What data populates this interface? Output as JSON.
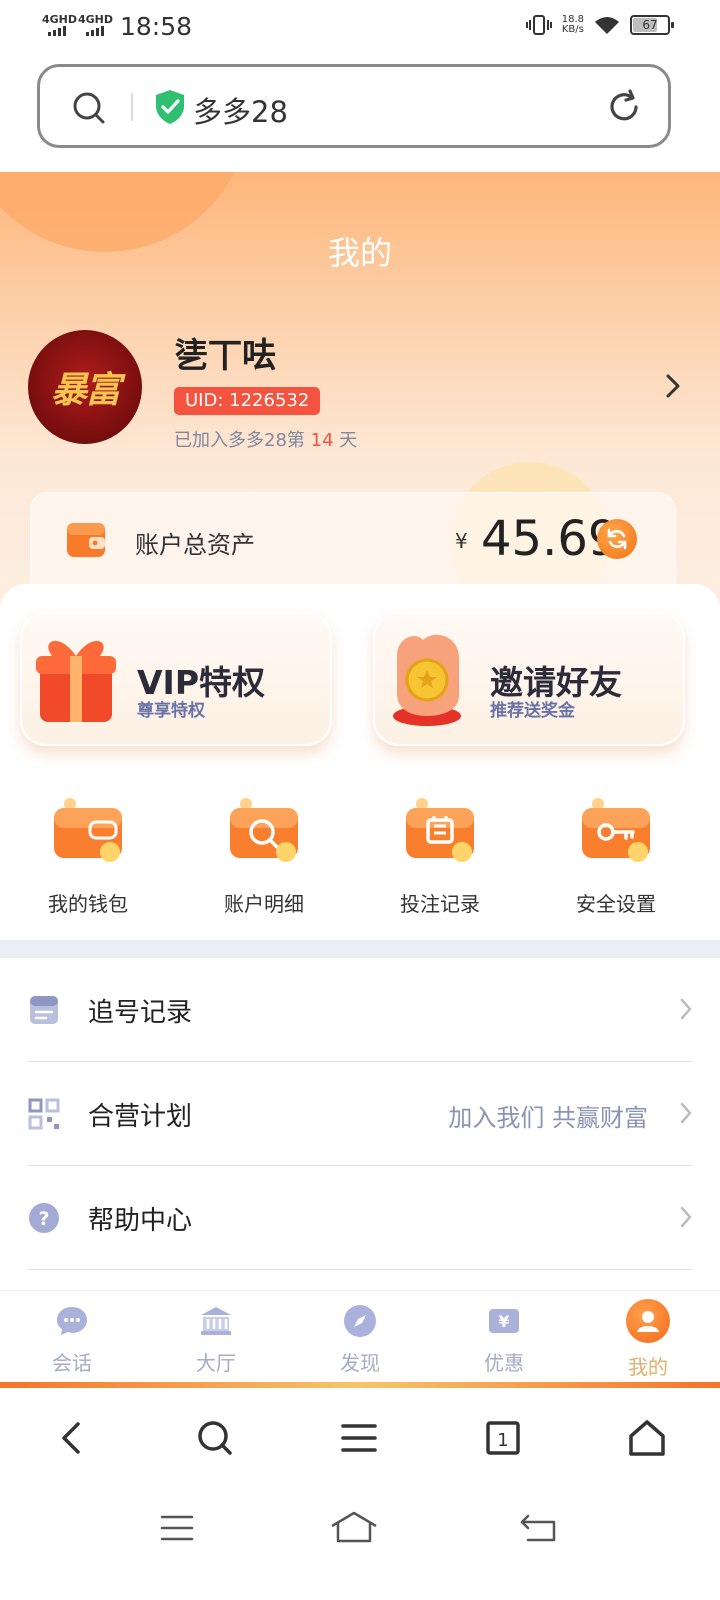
{
  "status": {
    "sig1": "4GHD",
    "sig2": "4GHD",
    "time": "18:58",
    "speed_value": "18.8",
    "speed_unit": "KB/s",
    "battery": "67"
  },
  "address_bar": {
    "url_text": "多多28",
    "secure": true
  },
  "header": {
    "title": "我的",
    "username": "乼丅呿",
    "uid": "UID: 1226532",
    "joined_prefix": "已加入多多28第",
    "joined_days": "14",
    "joined_suffix": "天",
    "avatar_text": "暴富"
  },
  "asset": {
    "label": "账户总资产",
    "currency": "¥",
    "value": "45.69"
  },
  "promos": [
    {
      "title": "VIP特权",
      "subtitle": "尊享特权",
      "icon": "gift-box-icon"
    },
    {
      "title": "邀请好友",
      "subtitle": "推荐送奖金",
      "icon": "coin-hand-icon"
    }
  ],
  "quick_actions": [
    {
      "label": "我的钱包",
      "icon": "wallet-icon"
    },
    {
      "label": "账户明细",
      "icon": "magnifier-icon"
    },
    {
      "label": "投注记录",
      "icon": "record-icon"
    },
    {
      "label": "安全设置",
      "icon": "key-icon"
    }
  ],
  "menu": [
    {
      "label": "追号记录",
      "extra": "",
      "icon": "clipboard-icon"
    },
    {
      "label": "合营计划",
      "extra": "加入我们 共赢财富",
      "icon": "qr-code-icon"
    },
    {
      "label": "帮助中心",
      "extra": "",
      "icon": "help-icon"
    }
  ],
  "tabs": [
    {
      "label": "会话",
      "icon": "chat-icon",
      "active": false
    },
    {
      "label": "大厅",
      "icon": "hall-icon",
      "active": false
    },
    {
      "label": "发现",
      "icon": "compass-icon",
      "active": false
    },
    {
      "label": "优惠",
      "icon": "yen-ticket-icon",
      "active": false
    },
    {
      "label": "我的",
      "icon": "user-icon",
      "active": true
    }
  ],
  "colors": {
    "accent": "#f4743a",
    "uid_badge": "#f4543f",
    "tab_inactive": "#a7acc6",
    "tab_active": "#e0b06f",
    "shield": "#2fbf71"
  }
}
